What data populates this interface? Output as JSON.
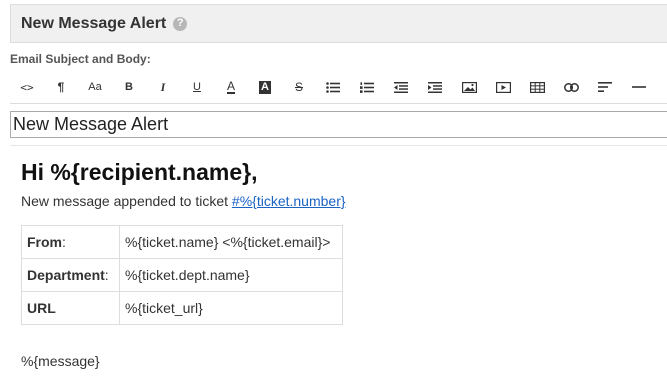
{
  "header": {
    "title": "New Message Alert",
    "help_icon": "?"
  },
  "section_label": "Email Subject and Body:",
  "toolbar": {
    "buttons": [
      {
        "name": "code-view",
        "icon": "code-icon",
        "glyph": "<>"
      },
      {
        "name": "paragraph",
        "icon": "paragraph-icon",
        "glyph": "¶"
      },
      {
        "name": "font-size",
        "icon": "font-size-icon",
        "glyph": "Aa"
      },
      {
        "name": "bold",
        "icon": "bold-icon",
        "glyph": "B"
      },
      {
        "name": "italic",
        "icon": "italic-icon",
        "glyph": "I"
      },
      {
        "name": "underline",
        "icon": "underline-icon",
        "glyph": "U"
      },
      {
        "name": "font-color",
        "icon": "font-color-icon",
        "glyph": "A"
      },
      {
        "name": "background-color",
        "icon": "background-color-icon",
        "glyph": "A"
      },
      {
        "name": "strikethrough",
        "icon": "strikethrough-icon",
        "glyph": "S"
      },
      {
        "name": "unordered-list",
        "icon": "bullet-list-icon"
      },
      {
        "name": "ordered-list",
        "icon": "numbered-list-icon"
      },
      {
        "name": "outdent",
        "icon": "outdent-icon"
      },
      {
        "name": "indent",
        "icon": "indent-icon"
      },
      {
        "name": "image",
        "icon": "image-icon"
      },
      {
        "name": "video",
        "icon": "video-icon"
      },
      {
        "name": "table",
        "icon": "table-icon"
      },
      {
        "name": "link",
        "icon": "link-icon"
      },
      {
        "name": "align",
        "icon": "align-left-icon"
      },
      {
        "name": "horizontal-rule",
        "icon": "horizontal-rule-icon"
      }
    ]
  },
  "subject": {
    "value": "New Message Alert"
  },
  "body": {
    "greeting": "Hi %{recipient.name},",
    "intro_text": "New message appended to ticket ",
    "ticket_link": "#%{ticket.number}",
    "table": [
      {
        "key": "From",
        "suffix": ":",
        "value": "%{ticket.name} <%{ticket.email}>"
      },
      {
        "key": "Department",
        "suffix": ":",
        "value": "%{ticket.dept.name}"
      },
      {
        "key": "URL",
        "suffix": "",
        "value": "%{ticket_url}"
      }
    ],
    "message": "%{message}"
  },
  "colors": {
    "link": "#1a63c4",
    "header_bg": "#f0f0f0",
    "border": "#dddddd"
  }
}
